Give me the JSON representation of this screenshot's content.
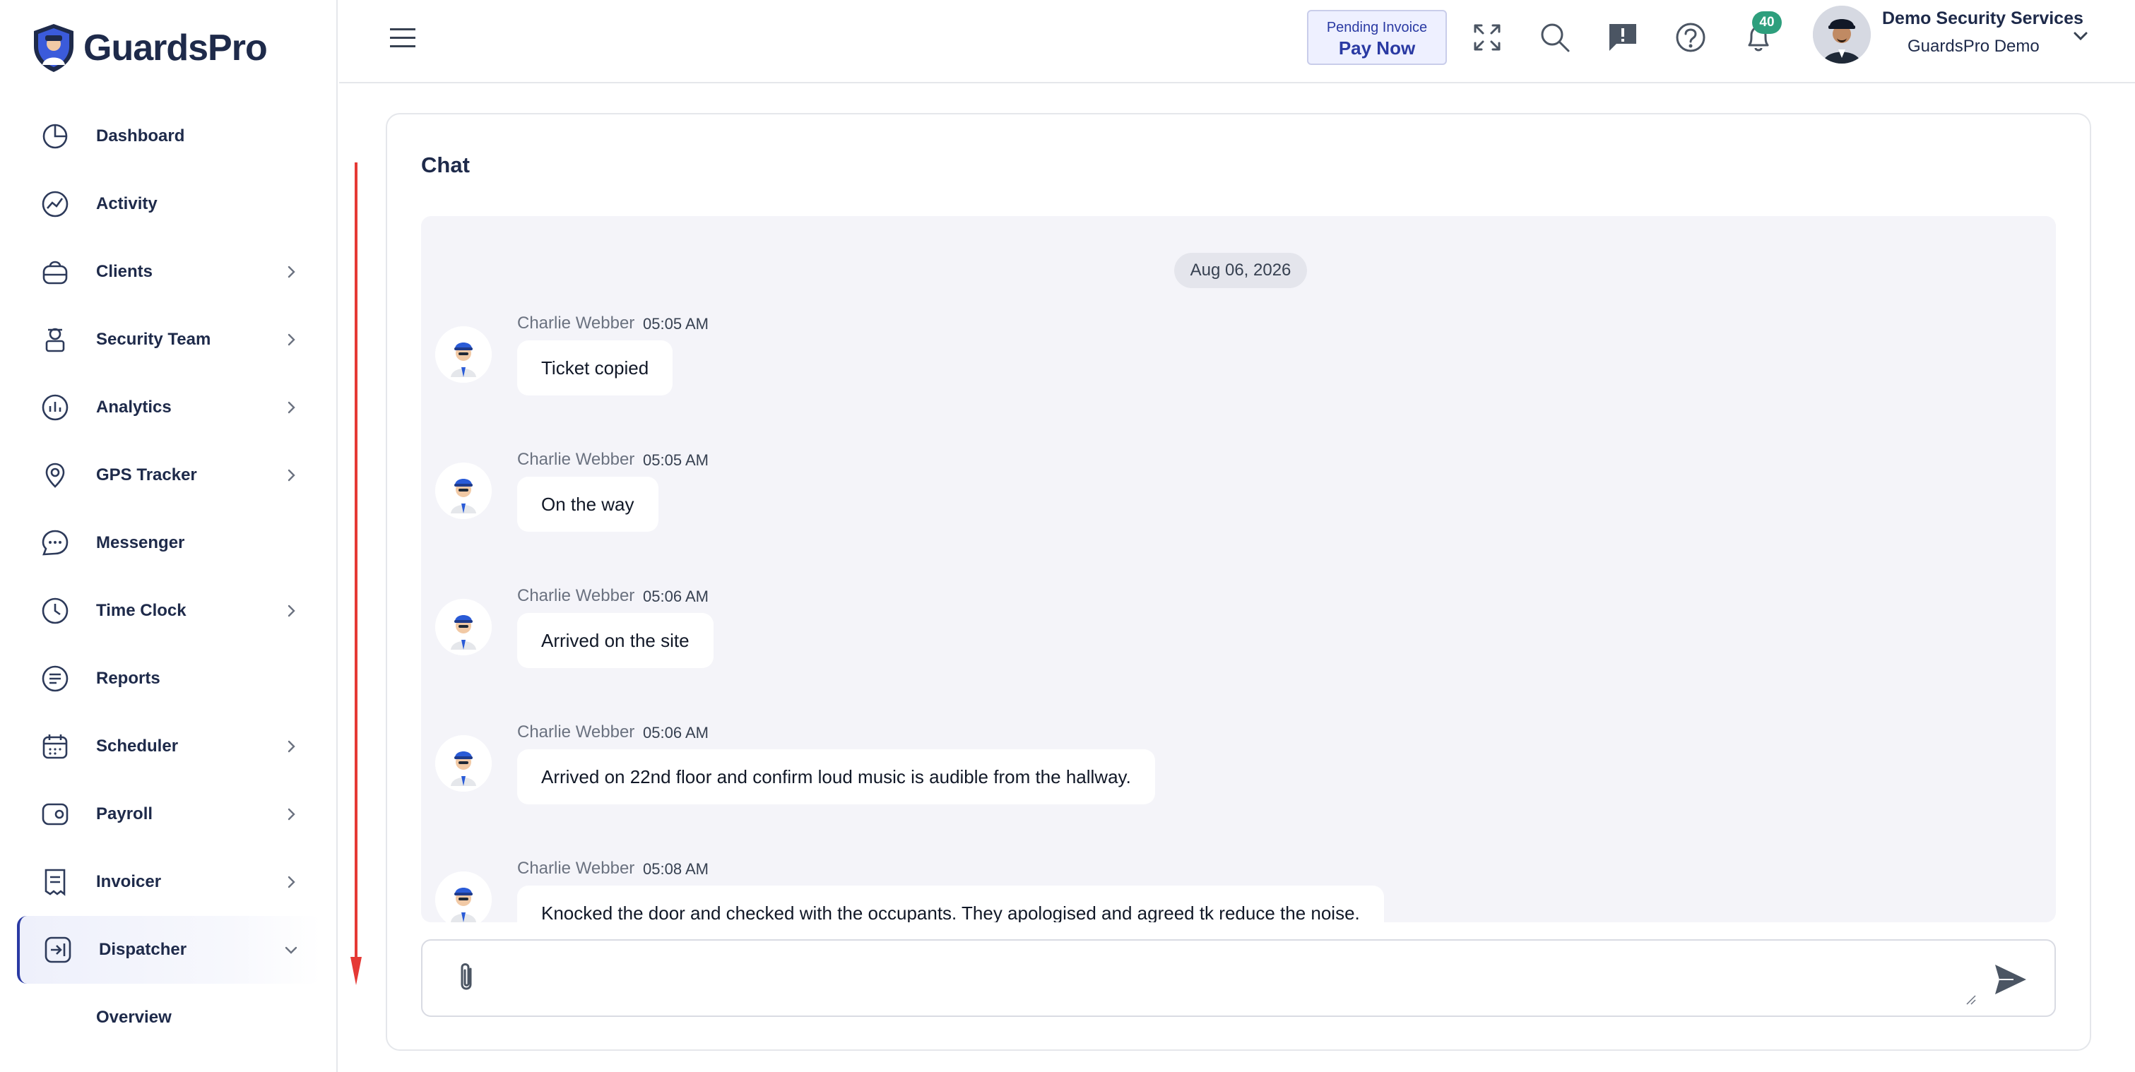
{
  "app": {
    "brand_name": "GuardsPro",
    "brand_color": "#1e2a4a",
    "accent": "#2a3aa3"
  },
  "sidebar": {
    "items": [
      {
        "label": "Dashboard",
        "icon": "dashboard-icon",
        "has_chevron": false
      },
      {
        "label": "Activity",
        "icon": "activity-icon",
        "has_chevron": false
      },
      {
        "label": "Clients",
        "icon": "clients-icon",
        "has_chevron": true
      },
      {
        "label": "Security Team",
        "icon": "security-team-icon",
        "has_chevron": true
      },
      {
        "label": "Analytics",
        "icon": "analytics-icon",
        "has_chevron": true
      },
      {
        "label": "GPS Tracker",
        "icon": "gps-icon",
        "has_chevron": true
      },
      {
        "label": "Messenger",
        "icon": "messenger-icon",
        "has_chevron": false
      },
      {
        "label": "Time Clock",
        "icon": "clock-icon",
        "has_chevron": true
      },
      {
        "label": "Reports",
        "icon": "reports-icon",
        "has_chevron": false
      },
      {
        "label": "Scheduler",
        "icon": "calendar-icon",
        "has_chevron": true
      },
      {
        "label": "Payroll",
        "icon": "wallet-icon",
        "has_chevron": true
      },
      {
        "label": "Invoicer",
        "icon": "invoice-icon",
        "has_chevron": true
      },
      {
        "label": "Dispatcher",
        "icon": "dispatcher-icon",
        "has_chevron": true,
        "active": true,
        "expanded": true
      }
    ],
    "subitems": [
      {
        "label": "Overview"
      }
    ]
  },
  "topbar": {
    "pending_invoice_label": "Pending Invoice",
    "pay_now_label": "Pay Now",
    "notification_count": "40",
    "user_name": "Demo Security Services",
    "user_org": "GuardsPro Demo"
  },
  "chat": {
    "title": "Chat",
    "date": "Aug 06, 2026",
    "messages": [
      {
        "sender": "Charlie Webber",
        "time": "05:05 AM",
        "text": "Ticket copied"
      },
      {
        "sender": "Charlie Webber",
        "time": "05:05 AM",
        "text": "On the way"
      },
      {
        "sender": "Charlie Webber",
        "time": "05:06 AM",
        "text": "Arrived on the site"
      },
      {
        "sender": "Charlie Webber",
        "time": "05:06 AM",
        "text": "Arrived on 22nd floor and confirm loud music is audible from the hallway."
      },
      {
        "sender": "Charlie Webber",
        "time": "05:08 AM",
        "text": "Knocked the door and checked with the occupants. They apologised and agreed tk reduce the noise."
      }
    ],
    "input_value": ""
  }
}
